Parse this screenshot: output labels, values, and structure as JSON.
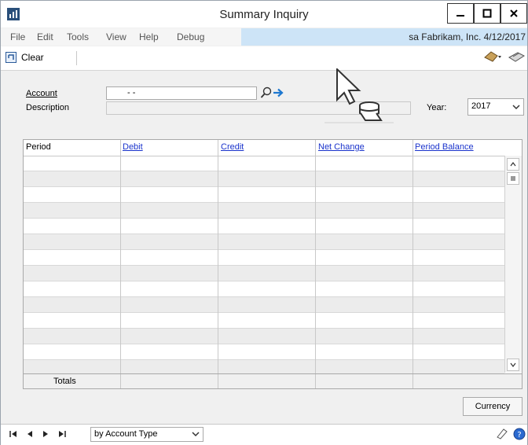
{
  "window": {
    "title": "Summary Inquiry"
  },
  "menu": {
    "items": [
      "File",
      "Edit",
      "Tools",
      "View",
      "Help",
      "Debug"
    ],
    "company": "sa  Fabrikam, Inc. 4/12/2017"
  },
  "toolbar": {
    "clear_label": "Clear"
  },
  "form": {
    "account_label": "Account",
    "account_value": "-        -",
    "description_label": "Description",
    "year_label": "Year:",
    "year_value": "2017"
  },
  "grid": {
    "columns": [
      "Period",
      "Debit",
      "Credit",
      "Net Change",
      "Period Balance"
    ],
    "row_count": 14,
    "totals_label": "Totals"
  },
  "buttons": {
    "currency_label": "Currency"
  },
  "status": {
    "sort_value": "by Account Type"
  },
  "colors": {
    "link": "#1a33cc",
    "company_bar": "#cde4f7",
    "accent": "#2a5a9a"
  }
}
